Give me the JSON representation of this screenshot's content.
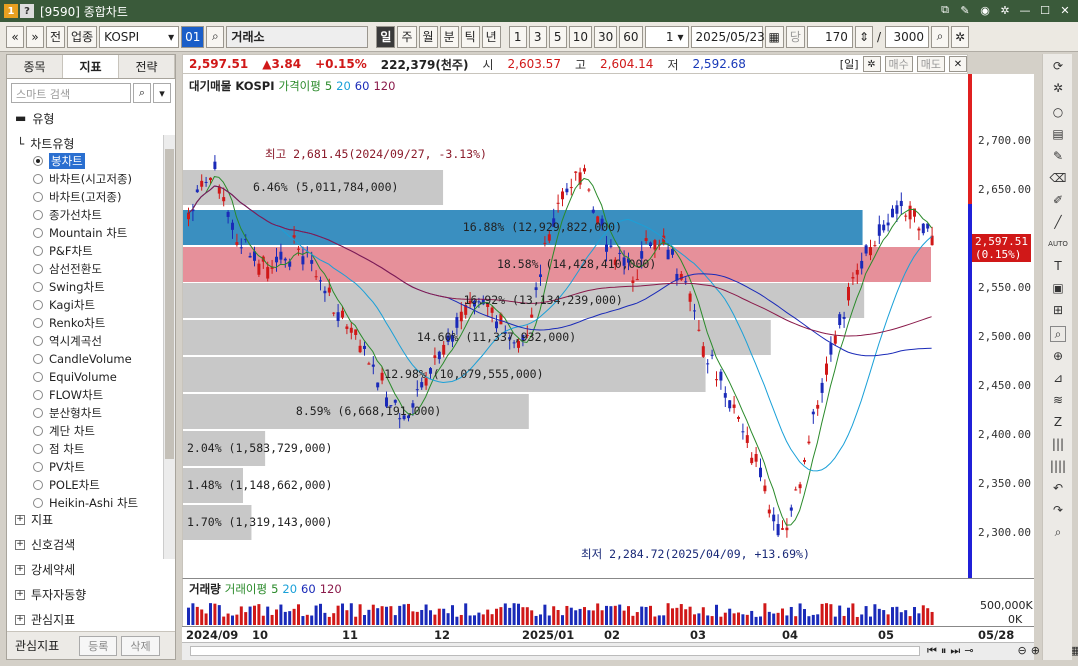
{
  "window": {
    "title": "[9590] 종합차트",
    "badge1": "1",
    "badge2": "?"
  },
  "toolbar": {
    "market": "업종",
    "symbol": "KOSPI",
    "code": "01",
    "exchange": "거래소",
    "periods": [
      "일",
      "주",
      "월",
      "분",
      "틱",
      "년"
    ],
    "active_period": "일",
    "intervals": [
      "1",
      "3",
      "5",
      "10",
      "30",
      "60"
    ],
    "count_sel": "1",
    "date": "2025/05/23",
    "dang": "당",
    "bars": "170",
    "slash": "/",
    "max_bars": "3000",
    "prev_label": "전"
  },
  "sidebar": {
    "tabs": [
      "종목",
      "지표",
      "전략"
    ],
    "active_tab": "지표",
    "search_placeholder": "스마트 검색",
    "section_title": "유형",
    "group_title": "차트유형",
    "items": [
      {
        "label": "봉차트",
        "selected": true
      },
      {
        "label": "바차트(시고저종)",
        "selected": false
      },
      {
        "label": "바차트(고저종)",
        "selected": false
      },
      {
        "label": "종가선차트",
        "selected": false
      },
      {
        "label": "Mountain 차트",
        "selected": false
      },
      {
        "label": "P&F차트",
        "selected": false
      },
      {
        "label": "삼선전환도",
        "selected": false
      },
      {
        "label": "Swing차트",
        "selected": false
      },
      {
        "label": "Kagi차트",
        "selected": false
      },
      {
        "label": "Renko차트",
        "selected": false
      },
      {
        "label": "역시계곡선",
        "selected": false
      },
      {
        "label": "CandleVolume",
        "selected": false
      },
      {
        "label": "EquiVolume",
        "selected": false
      },
      {
        "label": "FLOW차트",
        "selected": false
      },
      {
        "label": "분산형차트",
        "selected": false
      },
      {
        "label": "계단 차트",
        "selected": false
      },
      {
        "label": "점 차트",
        "selected": false
      },
      {
        "label": "PV차트",
        "selected": false
      },
      {
        "label": "POLE차트",
        "selected": false
      },
      {
        "label": "Heikin-Ashi 차트",
        "selected": false
      }
    ],
    "nodes": [
      "지표",
      "신호검색",
      "강세약세",
      "투자자동향",
      "관심지표"
    ],
    "footer_title": "관심지표",
    "footer_btn1": "등록",
    "footer_btn2": "삭제"
  },
  "info": {
    "price": "2,597.51",
    "change": "▲3.84",
    "pct": "+0.15%",
    "volume": "222,379(천주)",
    "open_label": "시",
    "open": "2,603.57",
    "high_label": "고",
    "high": "2,604.14",
    "low_label": "저",
    "low": "2,592.68",
    "mode": "[일]",
    "buy": "매수",
    "sell": "매도"
  },
  "legend": {
    "main": "대기매물",
    "symbol": "KOSPI",
    "ma_label": "가격이평",
    "ma": [
      "5",
      "20",
      "60",
      "120"
    ]
  },
  "vol_legend": {
    "main": "거래량",
    "ma_label": "거래이평",
    "ma": [
      "5",
      "20",
      "60",
      "120"
    ]
  },
  "annotations": {
    "high": "최고 2,681.45(2024/09/27, -3.13%)",
    "low": "최저 2,284.72(2025/04/09, +13.69%)",
    "current_price": "2,597.51",
    "current_pct": "(0.15%)"
  },
  "chart_data": {
    "type": "candlestick",
    "title": "",
    "y_ticks": [
      "2,700.00",
      "2,650.00",
      "2,600.00",
      "2,550.00",
      "2,500.00",
      "2,450.00",
      "2,400.00",
      "2,350.00",
      "2,300.00"
    ],
    "x_ticks": [
      "2024/09",
      "10",
      "11",
      "12",
      "2025/01",
      "02",
      "03",
      "04",
      "05",
      "05/28"
    ],
    "vol_ticks": [
      "500,000K",
      "0K"
    ],
    "volume_profile": [
      {
        "label": "6.46% (5,011,784,000)",
        "pct": 6.46
      },
      {
        "label": "16.88% (12,929,822,000)",
        "pct": 16.88
      },
      {
        "label": "18.58% (14,428,410,000)",
        "pct": 18.58
      },
      {
        "label": "16.92% (13,134,239,000)",
        "pct": 16.92
      },
      {
        "label": "14.60% (11,337,932,000)",
        "pct": 14.6
      },
      {
        "label": "12.98% (10,079,555,000)",
        "pct": 12.98
      },
      {
        "label": "8.59% (6,668,191,000)",
        "pct": 8.59
      },
      {
        "label": "2.04% (1,583,729,000)",
        "pct": 2.04
      },
      {
        "label": "1.48% (1,148,662,000)",
        "pct": 1.48
      },
      {
        "label": "1.70% (1,319,143,000)",
        "pct": 1.7
      }
    ]
  }
}
